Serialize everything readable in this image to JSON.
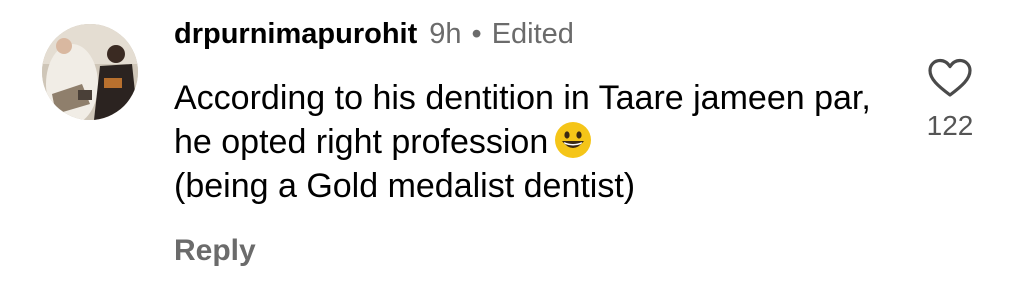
{
  "comment": {
    "username": "drpurnimapurohit",
    "time": "9h",
    "separator": "•",
    "edited": "Edited",
    "text": "According to his dentition in Taare jameen par, he opted right profession",
    "text_line2": "(being a Gold medalist dentist)",
    "emoji": "grinning-face",
    "reply_label": "Reply",
    "like_count": "122",
    "like_icon": "heart-outline-icon"
  },
  "colors": {
    "primary_text": "#000000",
    "secondary_text": "#6b6b6b",
    "emoji_fill": "#f5c518"
  }
}
